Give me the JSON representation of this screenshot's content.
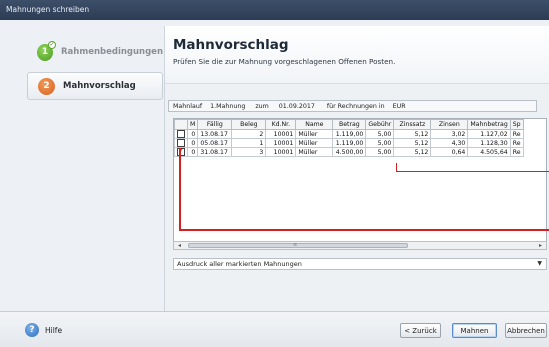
{
  "window": {
    "title": "Mahnungen schreiben"
  },
  "sidebar": {
    "steps": [
      {
        "number": "1",
        "label": "Rahmenbedingungen",
        "state": "done"
      },
      {
        "number": "2",
        "label": "Mahnvorschlag",
        "state": "active"
      }
    ]
  },
  "header": {
    "title": "Mahnvorschlag",
    "subtitle": "Prüfen Sie die zur Mahnung vorgeschlagenen Offenen Posten."
  },
  "filter": {
    "label1": "Mahnlauf",
    "value1": "1.Mahnung",
    "label2": "zum",
    "date": "01.09.2017",
    "label3": "für Rechnungen in",
    "currency": "EUR"
  },
  "table": {
    "columns": [
      "",
      "M",
      "Fällig",
      "Beleg",
      "Kd.Nr.",
      "Name",
      "Betrag",
      "Gebühr",
      "Zinssatz",
      "Zinsen",
      "Mahnbetrag",
      "Sp"
    ],
    "rows": [
      {
        "checked": false,
        "m": "0",
        "faellig": "13.08.17",
        "beleg": "2",
        "kdnr": "10001",
        "name": "Müller",
        "betrag": "1.119,00",
        "gebuehr": "5,00",
        "zinssatz": "5,12",
        "zinsen": "3,02",
        "mahnbetrag": "1.127,02",
        "sp": "Re"
      },
      {
        "checked": false,
        "m": "0",
        "faellig": "05.08.17",
        "beleg": "1",
        "kdnr": "10001",
        "name": "Müller",
        "betrag": "1.119,00",
        "gebuehr": "5,00",
        "zinssatz": "5,12",
        "zinsen": "4,30",
        "mahnbetrag": "1.128,30",
        "sp": "Re"
      },
      {
        "checked": true,
        "m": "0",
        "faellig": "31.08.17",
        "beleg": "3",
        "kdnr": "10001",
        "name": "Müller",
        "betrag": "4.500,00",
        "gebuehr": "5,00",
        "zinssatz": "5,12",
        "zinsen": "0,64",
        "mahnbetrag": "4.505,64",
        "sp": "Re"
      }
    ]
  },
  "print_option": {
    "selected": "Ausdruck aller markierten Mahnungen"
  },
  "footer": {
    "help_label": "Hilfe",
    "back_label": "< Zurück",
    "dun_label": "Mahnen",
    "cancel_label": "Abbrechen"
  },
  "colors": {
    "highlight": "#d32020",
    "titlebar": "#2f405a"
  }
}
